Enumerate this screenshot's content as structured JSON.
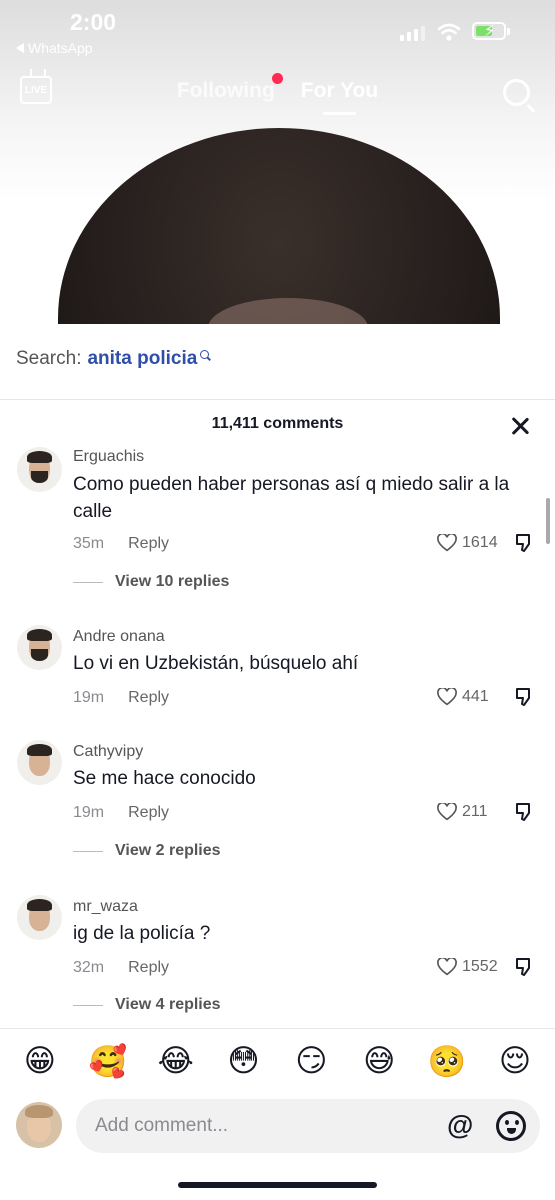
{
  "status_bar": {
    "time": "2:00",
    "back_app": "WhatsApp"
  },
  "top_nav": {
    "live_label": "LIVE",
    "tabs": [
      {
        "label": "Following"
      },
      {
        "label": "For You"
      }
    ],
    "active_tab": "For You"
  },
  "search_suggestion": {
    "prefix": "Search:",
    "term": "anita policia"
  },
  "comments_panel": {
    "count_label": "11,411 comments",
    "comments": [
      {
        "username": "Erguachis",
        "text": "Como pueden haber personas así q miedo salir a la calle",
        "time": "35m",
        "reply_label": "Reply",
        "likes": "1614",
        "view_replies": "View 10 replies"
      },
      {
        "username": "Andre onana",
        "text": "Lo vi en Uzbekistán, búsquelo ahí",
        "time": "19m",
        "reply_label": "Reply",
        "likes": "441",
        "view_replies": ""
      },
      {
        "username": "Cathyvipy",
        "text": "Se me hace conocido",
        "time": "19m",
        "reply_label": "Reply",
        "likes": "211",
        "view_replies": "View 2 replies"
      },
      {
        "username": "mr_waza",
        "text": "ig de la policía ?",
        "time": "32m",
        "reply_label": "Reply",
        "likes": "1552",
        "view_replies": "View 4 replies"
      }
    ]
  },
  "emoji_bar": [
    "😁",
    "🥰",
    "😂",
    "😳",
    "😏",
    "😅",
    "🥺",
    "😌"
  ],
  "composer": {
    "placeholder": "Add comment...",
    "at_symbol": "@"
  },
  "colors": {
    "accent_red": "#fe2c55",
    "search_term_blue": "#2f4fa8"
  }
}
